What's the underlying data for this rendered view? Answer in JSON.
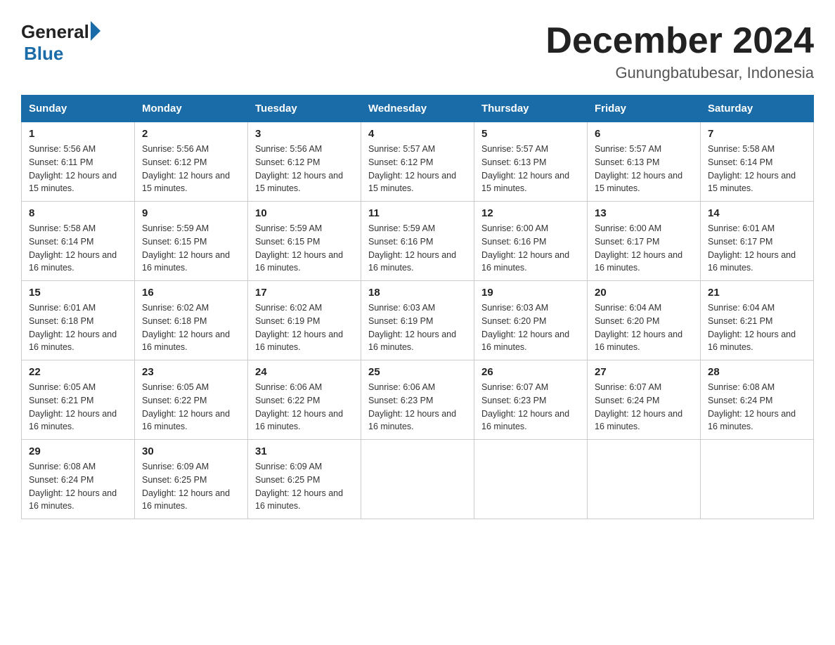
{
  "header": {
    "logo_general": "General",
    "logo_blue": "Blue",
    "title": "December 2024",
    "subtitle": "Gunungbatubesar, Indonesia"
  },
  "weekdays": [
    "Sunday",
    "Monday",
    "Tuesday",
    "Wednesday",
    "Thursday",
    "Friday",
    "Saturday"
  ],
  "weeks": [
    [
      {
        "day": "1",
        "sunrise": "5:56 AM",
        "sunset": "6:11 PM",
        "daylight": "12 hours and 15 minutes."
      },
      {
        "day": "2",
        "sunrise": "5:56 AM",
        "sunset": "6:12 PM",
        "daylight": "12 hours and 15 minutes."
      },
      {
        "day": "3",
        "sunrise": "5:56 AM",
        "sunset": "6:12 PM",
        "daylight": "12 hours and 15 minutes."
      },
      {
        "day": "4",
        "sunrise": "5:57 AM",
        "sunset": "6:12 PM",
        "daylight": "12 hours and 15 minutes."
      },
      {
        "day": "5",
        "sunrise": "5:57 AM",
        "sunset": "6:13 PM",
        "daylight": "12 hours and 15 minutes."
      },
      {
        "day": "6",
        "sunrise": "5:57 AM",
        "sunset": "6:13 PM",
        "daylight": "12 hours and 15 minutes."
      },
      {
        "day": "7",
        "sunrise": "5:58 AM",
        "sunset": "6:14 PM",
        "daylight": "12 hours and 15 minutes."
      }
    ],
    [
      {
        "day": "8",
        "sunrise": "5:58 AM",
        "sunset": "6:14 PM",
        "daylight": "12 hours and 16 minutes."
      },
      {
        "day": "9",
        "sunrise": "5:59 AM",
        "sunset": "6:15 PM",
        "daylight": "12 hours and 16 minutes."
      },
      {
        "day": "10",
        "sunrise": "5:59 AM",
        "sunset": "6:15 PM",
        "daylight": "12 hours and 16 minutes."
      },
      {
        "day": "11",
        "sunrise": "5:59 AM",
        "sunset": "6:16 PM",
        "daylight": "12 hours and 16 minutes."
      },
      {
        "day": "12",
        "sunrise": "6:00 AM",
        "sunset": "6:16 PM",
        "daylight": "12 hours and 16 minutes."
      },
      {
        "day": "13",
        "sunrise": "6:00 AM",
        "sunset": "6:17 PM",
        "daylight": "12 hours and 16 minutes."
      },
      {
        "day": "14",
        "sunrise": "6:01 AM",
        "sunset": "6:17 PM",
        "daylight": "12 hours and 16 minutes."
      }
    ],
    [
      {
        "day": "15",
        "sunrise": "6:01 AM",
        "sunset": "6:18 PM",
        "daylight": "12 hours and 16 minutes."
      },
      {
        "day": "16",
        "sunrise": "6:02 AM",
        "sunset": "6:18 PM",
        "daylight": "12 hours and 16 minutes."
      },
      {
        "day": "17",
        "sunrise": "6:02 AM",
        "sunset": "6:19 PM",
        "daylight": "12 hours and 16 minutes."
      },
      {
        "day": "18",
        "sunrise": "6:03 AM",
        "sunset": "6:19 PM",
        "daylight": "12 hours and 16 minutes."
      },
      {
        "day": "19",
        "sunrise": "6:03 AM",
        "sunset": "6:20 PM",
        "daylight": "12 hours and 16 minutes."
      },
      {
        "day": "20",
        "sunrise": "6:04 AM",
        "sunset": "6:20 PM",
        "daylight": "12 hours and 16 minutes."
      },
      {
        "day": "21",
        "sunrise": "6:04 AM",
        "sunset": "6:21 PM",
        "daylight": "12 hours and 16 minutes."
      }
    ],
    [
      {
        "day": "22",
        "sunrise": "6:05 AM",
        "sunset": "6:21 PM",
        "daylight": "12 hours and 16 minutes."
      },
      {
        "day": "23",
        "sunrise": "6:05 AM",
        "sunset": "6:22 PM",
        "daylight": "12 hours and 16 minutes."
      },
      {
        "day": "24",
        "sunrise": "6:06 AM",
        "sunset": "6:22 PM",
        "daylight": "12 hours and 16 minutes."
      },
      {
        "day": "25",
        "sunrise": "6:06 AM",
        "sunset": "6:23 PM",
        "daylight": "12 hours and 16 minutes."
      },
      {
        "day": "26",
        "sunrise": "6:07 AM",
        "sunset": "6:23 PM",
        "daylight": "12 hours and 16 minutes."
      },
      {
        "day": "27",
        "sunrise": "6:07 AM",
        "sunset": "6:24 PM",
        "daylight": "12 hours and 16 minutes."
      },
      {
        "day": "28",
        "sunrise": "6:08 AM",
        "sunset": "6:24 PM",
        "daylight": "12 hours and 16 minutes."
      }
    ],
    [
      {
        "day": "29",
        "sunrise": "6:08 AM",
        "sunset": "6:24 PM",
        "daylight": "12 hours and 16 minutes."
      },
      {
        "day": "30",
        "sunrise": "6:09 AM",
        "sunset": "6:25 PM",
        "daylight": "12 hours and 16 minutes."
      },
      {
        "day": "31",
        "sunrise": "6:09 AM",
        "sunset": "6:25 PM",
        "daylight": "12 hours and 16 minutes."
      },
      null,
      null,
      null,
      null
    ]
  ]
}
